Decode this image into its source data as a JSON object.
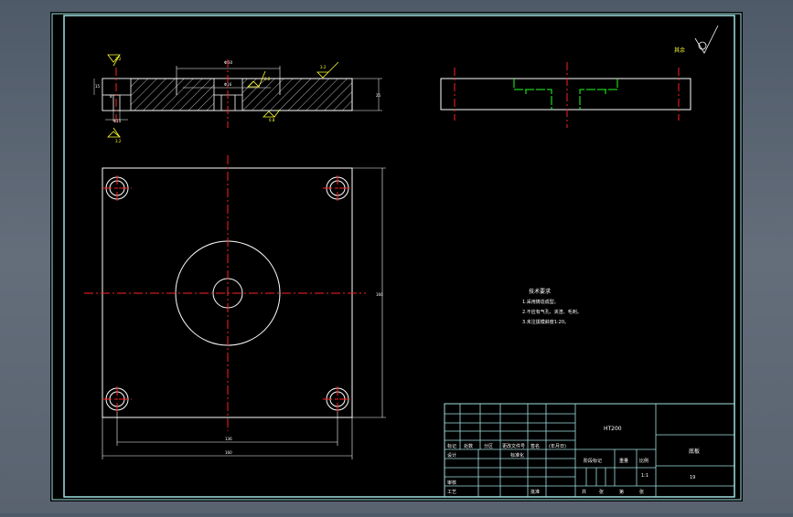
{
  "colors": {
    "background": "#000000",
    "outline": "#ffffff",
    "border": "#a0e0e0",
    "center_line": "#ff2020",
    "hidden_line": "#20ff20",
    "annotation": "#ffff30"
  },
  "roughness": {
    "others": "其余",
    "top_left": "3.2",
    "bottom_left": "3.2",
    "counterbore": "3.2",
    "bottom_mid": "0.8",
    "right": "3.2"
  },
  "section_dims": {
    "width_top": "Φ60",
    "inner": "Φ16",
    "hole": "Φ11",
    "height_left": "15",
    "height_right": "25",
    "depth": "8"
  },
  "plan_dims": {
    "inner_width": "136",
    "outer_width": "160",
    "height": "160"
  },
  "notes": {
    "title": "技术要求",
    "lines": [
      "1.采用铸造成型。",
      "2.不应有气孔、夹渣、毛刺。",
      "3.未注拔模斜度1:20。"
    ]
  },
  "title_block": {
    "material": "HT200",
    "rev_headers": [
      "标记",
      "处数",
      "分区",
      "更改文件号",
      "签名",
      "(年月日)"
    ],
    "design": "设计",
    "standardize": "标准化",
    "review": "审核",
    "process": "工艺",
    "approve": "批准",
    "stage_mark": "阶段标记",
    "weight": "重量",
    "scale": "比例",
    "scale_value": "1:1",
    "sheet_total": "共",
    "sheet_unit": "张",
    "sheet_no": "第",
    "sheet_unit2": "张",
    "part_name": "底板",
    "drawing_no": "19"
  }
}
